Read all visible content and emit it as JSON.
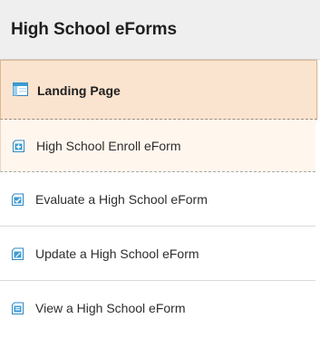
{
  "panel": {
    "title": "High School eForms"
  },
  "menu": {
    "items": [
      {
        "label": "Landing Page",
        "icon": "landing-page-icon",
        "active": true
      },
      {
        "label": "High School Enroll eForm",
        "icon": "add-form-icon",
        "active": false
      },
      {
        "label": "Evaluate a High School eForm",
        "icon": "evaluate-form-icon",
        "active": false
      },
      {
        "label": "Update a High School eForm",
        "icon": "update-form-icon",
        "active": false
      },
      {
        "label": "View a High School eForm",
        "icon": "view-form-icon",
        "active": false
      }
    ]
  },
  "colors": {
    "header_bg": "#efefef",
    "active_bg": "#fbe4cf",
    "active_border": "#ddb78f",
    "hover_bg": "#fff6ee",
    "icon_blue": "#3d9cd2"
  }
}
